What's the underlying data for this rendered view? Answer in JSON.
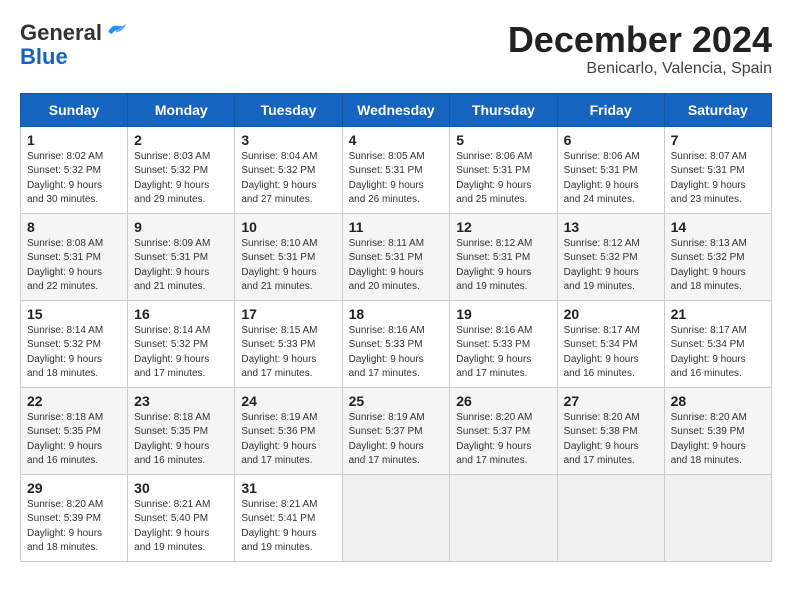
{
  "header": {
    "logo_general": "General",
    "logo_blue": "Blue",
    "month_title": "December 2024",
    "location": "Benicarlo, Valencia, Spain"
  },
  "columns": [
    "Sunday",
    "Monday",
    "Tuesday",
    "Wednesday",
    "Thursday",
    "Friday",
    "Saturday"
  ],
  "weeks": [
    [
      {
        "day": "1",
        "info": "Sunrise: 8:02 AM\nSunset: 5:32 PM\nDaylight: 9 hours\nand 30 minutes."
      },
      {
        "day": "2",
        "info": "Sunrise: 8:03 AM\nSunset: 5:32 PM\nDaylight: 9 hours\nand 29 minutes."
      },
      {
        "day": "3",
        "info": "Sunrise: 8:04 AM\nSunset: 5:32 PM\nDaylight: 9 hours\nand 27 minutes."
      },
      {
        "day": "4",
        "info": "Sunrise: 8:05 AM\nSunset: 5:31 PM\nDaylight: 9 hours\nand 26 minutes."
      },
      {
        "day": "5",
        "info": "Sunrise: 8:06 AM\nSunset: 5:31 PM\nDaylight: 9 hours\nand 25 minutes."
      },
      {
        "day": "6",
        "info": "Sunrise: 8:06 AM\nSunset: 5:31 PM\nDaylight: 9 hours\nand 24 minutes."
      },
      {
        "day": "7",
        "info": "Sunrise: 8:07 AM\nSunset: 5:31 PM\nDaylight: 9 hours\nand 23 minutes."
      }
    ],
    [
      {
        "day": "8",
        "info": "Sunrise: 8:08 AM\nSunset: 5:31 PM\nDaylight: 9 hours\nand 22 minutes."
      },
      {
        "day": "9",
        "info": "Sunrise: 8:09 AM\nSunset: 5:31 PM\nDaylight: 9 hours\nand 21 minutes."
      },
      {
        "day": "10",
        "info": "Sunrise: 8:10 AM\nSunset: 5:31 PM\nDaylight: 9 hours\nand 21 minutes."
      },
      {
        "day": "11",
        "info": "Sunrise: 8:11 AM\nSunset: 5:31 PM\nDaylight: 9 hours\nand 20 minutes."
      },
      {
        "day": "12",
        "info": "Sunrise: 8:12 AM\nSunset: 5:31 PM\nDaylight: 9 hours\nand 19 minutes."
      },
      {
        "day": "13",
        "info": "Sunrise: 8:12 AM\nSunset: 5:32 PM\nDaylight: 9 hours\nand 19 minutes."
      },
      {
        "day": "14",
        "info": "Sunrise: 8:13 AM\nSunset: 5:32 PM\nDaylight: 9 hours\nand 18 minutes."
      }
    ],
    [
      {
        "day": "15",
        "info": "Sunrise: 8:14 AM\nSunset: 5:32 PM\nDaylight: 9 hours\nand 18 minutes."
      },
      {
        "day": "16",
        "info": "Sunrise: 8:14 AM\nSunset: 5:32 PM\nDaylight: 9 hours\nand 17 minutes."
      },
      {
        "day": "17",
        "info": "Sunrise: 8:15 AM\nSunset: 5:33 PM\nDaylight: 9 hours\nand 17 minutes."
      },
      {
        "day": "18",
        "info": "Sunrise: 8:16 AM\nSunset: 5:33 PM\nDaylight: 9 hours\nand 17 minutes."
      },
      {
        "day": "19",
        "info": "Sunrise: 8:16 AM\nSunset: 5:33 PM\nDaylight: 9 hours\nand 17 minutes."
      },
      {
        "day": "20",
        "info": "Sunrise: 8:17 AM\nSunset: 5:34 PM\nDaylight: 9 hours\nand 16 minutes."
      },
      {
        "day": "21",
        "info": "Sunrise: 8:17 AM\nSunset: 5:34 PM\nDaylight: 9 hours\nand 16 minutes."
      }
    ],
    [
      {
        "day": "22",
        "info": "Sunrise: 8:18 AM\nSunset: 5:35 PM\nDaylight: 9 hours\nand 16 minutes."
      },
      {
        "day": "23",
        "info": "Sunrise: 8:18 AM\nSunset: 5:35 PM\nDaylight: 9 hours\nand 16 minutes."
      },
      {
        "day": "24",
        "info": "Sunrise: 8:19 AM\nSunset: 5:36 PM\nDaylight: 9 hours\nand 17 minutes."
      },
      {
        "day": "25",
        "info": "Sunrise: 8:19 AM\nSunset: 5:37 PM\nDaylight: 9 hours\nand 17 minutes."
      },
      {
        "day": "26",
        "info": "Sunrise: 8:20 AM\nSunset: 5:37 PM\nDaylight: 9 hours\nand 17 minutes."
      },
      {
        "day": "27",
        "info": "Sunrise: 8:20 AM\nSunset: 5:38 PM\nDaylight: 9 hours\nand 17 minutes."
      },
      {
        "day": "28",
        "info": "Sunrise: 8:20 AM\nSunset: 5:39 PM\nDaylight: 9 hours\nand 18 minutes."
      }
    ],
    [
      {
        "day": "29",
        "info": "Sunrise: 8:20 AM\nSunset: 5:39 PM\nDaylight: 9 hours\nand 18 minutes."
      },
      {
        "day": "30",
        "info": "Sunrise: 8:21 AM\nSunset: 5:40 PM\nDaylight: 9 hours\nand 19 minutes."
      },
      {
        "day": "31",
        "info": "Sunrise: 8:21 AM\nSunset: 5:41 PM\nDaylight: 9 hours\nand 19 minutes."
      },
      null,
      null,
      null,
      null
    ]
  ]
}
